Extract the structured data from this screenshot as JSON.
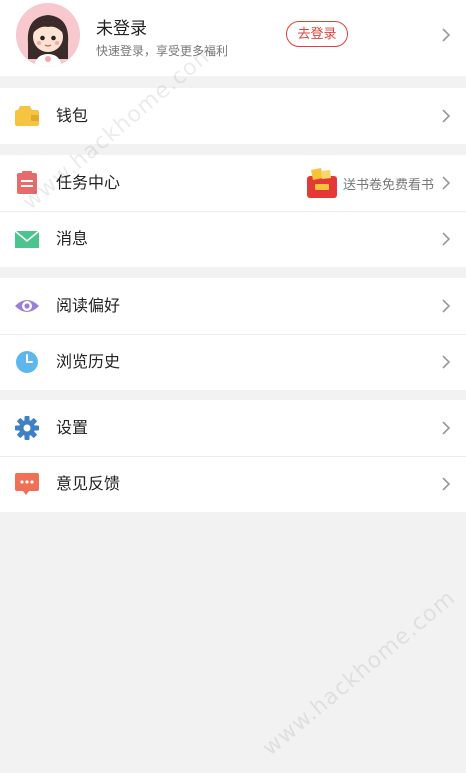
{
  "profile": {
    "name": "未登录",
    "subtitle": "快速登录，享受更多福利",
    "login_label": "去登录"
  },
  "groups": [
    {
      "items": [
        {
          "key": "wallet",
          "label": "钱包",
          "icon": "wallet-icon"
        }
      ]
    },
    {
      "items": [
        {
          "key": "tasks",
          "label": "任务中心",
          "icon": "clipboard-icon",
          "promo": "送书卷免费看书"
        },
        {
          "key": "messages",
          "label": "消息",
          "icon": "envelope-icon"
        }
      ]
    },
    {
      "items": [
        {
          "key": "reading-prefs",
          "label": "阅读偏好",
          "icon": "eye-icon"
        },
        {
          "key": "history",
          "label": "浏览历史",
          "icon": "clock-icon"
        }
      ]
    },
    {
      "items": [
        {
          "key": "settings",
          "label": "设置",
          "icon": "gear-icon"
        },
        {
          "key": "feedback",
          "label": "意见反馈",
          "icon": "chat-icon"
        }
      ]
    }
  ],
  "watermark": "www.hackhome.com",
  "colors": {
    "accent": "#e0413b",
    "wallet": "#f5c542",
    "tasks": "#e86a6a",
    "messages": "#4cc48e",
    "reading": "#9b7fd4",
    "history": "#5db7ec",
    "settings": "#3f7fc2",
    "feedback": "#f07056"
  }
}
